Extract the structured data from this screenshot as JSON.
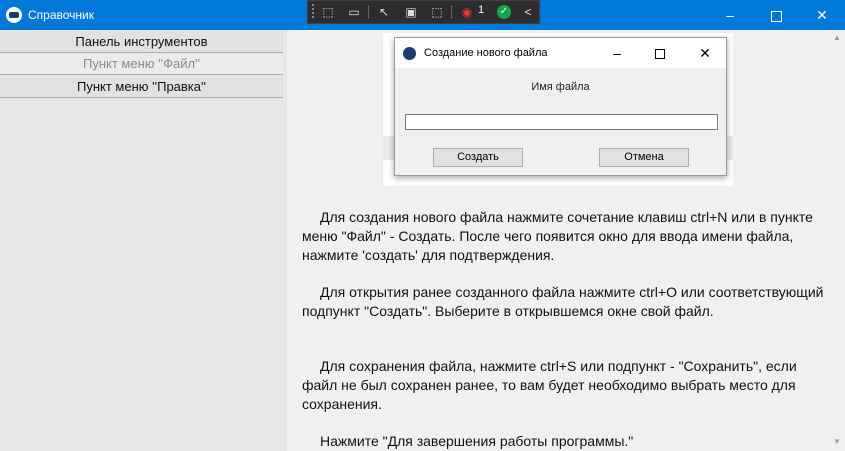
{
  "window": {
    "title": "Справочник",
    "minimize": "–",
    "close": "✕",
    "icon": "app-logo-icon"
  },
  "debug_toolbar": {
    "icons": [
      "select-element-icon",
      "video-icon",
      "pointer-icon",
      "frame-icon",
      "track-focus-icon",
      "hot-reload-icon",
      "check-icon",
      "collapse-icon"
    ],
    "counter": "1",
    "collapse": "<"
  },
  "sidebar": {
    "items": [
      {
        "label": "Панель инструментов",
        "enabled": true
      },
      {
        "label": "Пункт меню ''Файл''",
        "enabled": false
      },
      {
        "label": "Пункт меню ''Правка''",
        "enabled": true
      }
    ]
  },
  "dialog": {
    "title": "Создание нового файла",
    "minimize": "–",
    "close": "✕",
    "label": "Имя файла",
    "input_value": "",
    "create_button": "Создать",
    "cancel_button": "Отмена"
  },
  "content": {
    "paragraphs": [
      "Для создания нового файла нажмите сочетание клавиш ctrl+N или в пункте меню \"Файл\" - Создать. После чего появится окно для ввода имени файла, нажмите 'создать' для подтверждения.",
      "Для открытия ранее созданного файла нажмите ctrl+O или соответствующий подпункт \"Создать\". Выберите в открывшемся окне свой файл.",
      "Для сохранения файла, нажмите ctrl+S или подпункт - \"Сохранить\", если файл не был сохранен ранее, то вам будет необходимо выбрать место для сохранения.",
      "Нажмите \"Для завершения работы программы.\""
    ]
  },
  "colors": {
    "titlebar": "#0078d7",
    "debugbar": "#2d2d30",
    "panel": "#e6e6e6"
  }
}
